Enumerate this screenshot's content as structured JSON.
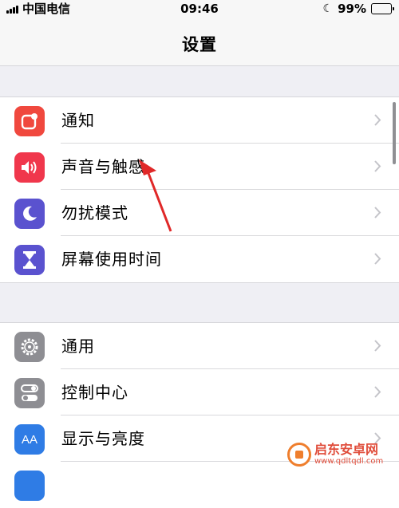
{
  "status": {
    "carrier": "中国电信",
    "time": "09:46",
    "battery": "99%",
    "battery_level": 0.99
  },
  "nav": {
    "title": "设置"
  },
  "group1": [
    {
      "label": "通知",
      "icon": "notifications-icon",
      "color": "#f0483e"
    },
    {
      "label": "声音与触感",
      "icon": "sounds-icon",
      "color": "#f0374c"
    },
    {
      "label": "勿扰模式",
      "icon": "moon-icon",
      "color": "#5a52cf"
    },
    {
      "label": "屏幕使用时间",
      "icon": "hourglass-icon",
      "color": "#5a52cf"
    }
  ],
  "group2": [
    {
      "label": "通用",
      "icon": "gear-icon",
      "color": "#8e8e93"
    },
    {
      "label": "控制中心",
      "icon": "toggles-icon",
      "color": "#8e8e93"
    },
    {
      "label": "显示与亮度",
      "icon": "text-size-icon",
      "icon_text": "AA",
      "color": "#2f7ce5"
    },
    {
      "label": "",
      "icon": "partial-icon",
      "color": "#2f7ce5"
    }
  ],
  "watermark": {
    "main": "启东安卓网",
    "sub": "www.qdltqdl.com"
  },
  "annotation": {
    "arrow_color": "#e02828"
  }
}
